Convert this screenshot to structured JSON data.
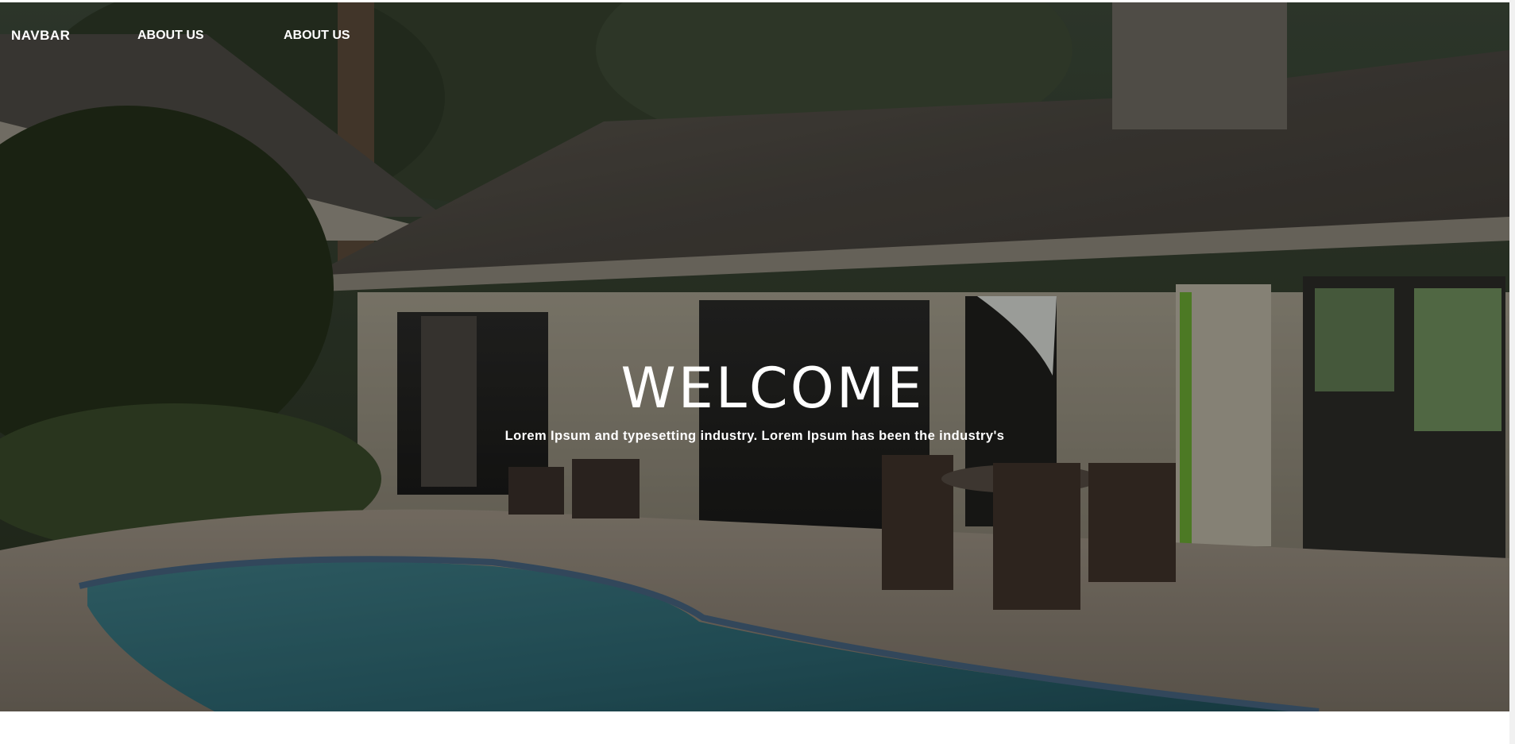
{
  "navbar": {
    "brand": "NAVBAR",
    "links": [
      {
        "label": "ABOUT US"
      },
      {
        "label": "ABOUT US"
      }
    ]
  },
  "hero": {
    "title": "WELCOME",
    "subtitle": "Lorem Ipsum and typesetting industry. Lorem Ipsum has been the industry's",
    "overlay_color": "#000000"
  },
  "colors": {
    "text": "#ffffff",
    "page_background": "#ffffff"
  }
}
